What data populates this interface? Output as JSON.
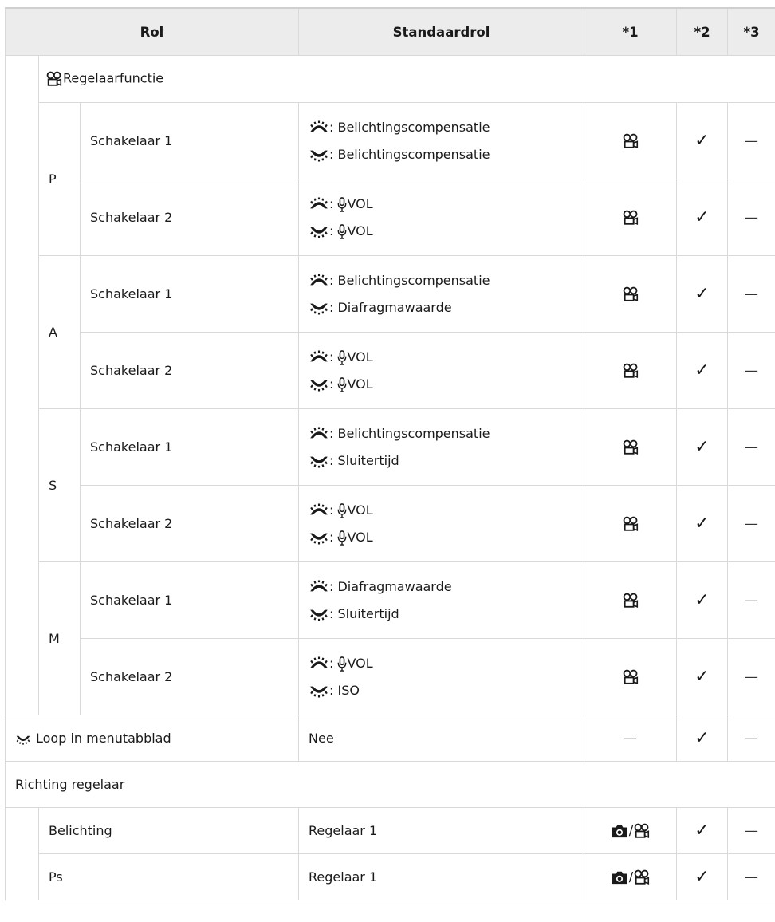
{
  "headers": {
    "rol": "Rol",
    "standaardrol": "Standaardrol",
    "n1": "*1",
    "n2": "*2",
    "n3": "*3"
  },
  "section_regelaarfunctie": "Regelaarfunctie",
  "modes": [
    {
      "mode": "P",
      "rows": [
        {
          "switch": "Schakelaar 1",
          "front": ": Belichtingscompensatie",
          "rear": ": Belichtingscompensatie"
        },
        {
          "switch": "Schakelaar 2",
          "front": "VOL",
          "rear": "VOL"
        }
      ]
    },
    {
      "mode": "A",
      "rows": [
        {
          "switch": "Schakelaar 1",
          "front": ": Belichtingscompensatie",
          "rear": ": Diafragmawaarde"
        },
        {
          "switch": "Schakelaar 2",
          "front": "VOL",
          "rear": "VOL"
        }
      ]
    },
    {
      "mode": "S",
      "rows": [
        {
          "switch": "Schakelaar 1",
          "front": ": Belichtingscompensatie",
          "rear": ": Sluitertijd"
        },
        {
          "switch": "Schakelaar 2",
          "front": "VOL",
          "rear": "VOL"
        }
      ]
    },
    {
      "mode": "M",
      "rows": [
        {
          "switch": "Schakelaar 1",
          "front": ": Diafragmawaarde",
          "rear": ": Sluitertijd"
        },
        {
          "switch": "Schakelaar 2",
          "front": "VOL",
          "rear": ": ISO"
        }
      ]
    }
  ],
  "loop_row": {
    "label": "Loop in menutabblad",
    "value": "Nee",
    "n1": "—",
    "n3": "—"
  },
  "section_richting": "Richting regelaar",
  "richting_rows": [
    {
      "label": "Belichting",
      "value": "Regelaar 1",
      "n3": "—"
    },
    {
      "label": "Ps",
      "value": "Regelaar 1",
      "n3": "—"
    }
  ],
  "dash": "—",
  "colon": ": ",
  "slash": "/"
}
